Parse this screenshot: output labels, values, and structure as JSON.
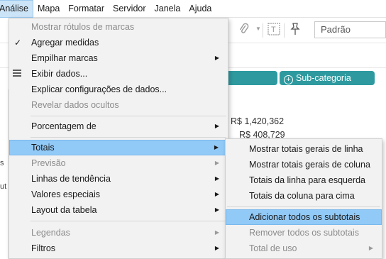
{
  "menubar": {
    "items": [
      {
        "label": "Análise",
        "active": true
      },
      {
        "label": "Mapa"
      },
      {
        "label": "Formatar"
      },
      {
        "label": "Servidor"
      },
      {
        "label": "Janela"
      },
      {
        "label": "Ajuda"
      }
    ]
  },
  "toolbar": {
    "format_value": "Padrão"
  },
  "shelf": {
    "pill_label": "Sub-categoria",
    "pill_color": "#2e9a9f"
  },
  "canvas": {
    "value_1": "R$ 1,420,362",
    "value_2": "R$ 408,729"
  },
  "left_strip": {
    "text_1": "s",
    "text_2": "ut"
  },
  "analise_menu": {
    "items": [
      {
        "label": "Mostrar rótulos de marcas",
        "disabled": true
      },
      {
        "label": "Agregar medidas",
        "checked": true
      },
      {
        "label": "Empilhar marcas",
        "submenu": true
      },
      {
        "label": "Exibir dados...",
        "icon": "data-grid-icon"
      },
      {
        "label": "Explicar configurações de dados..."
      },
      {
        "label": "Revelar dados ocultos",
        "disabled": true
      },
      {
        "label": "Porcentagem de",
        "submenu": true
      },
      {
        "label": "Totais",
        "submenu": true,
        "highlighted": true
      },
      {
        "label": "Previsão",
        "submenu": true,
        "disabled": true
      },
      {
        "label": "Linhas de tendência",
        "submenu": true
      },
      {
        "label": "Valores especiais",
        "submenu": true
      },
      {
        "label": "Layout da tabela",
        "submenu": true
      },
      {
        "label": "Legendas",
        "submenu": true,
        "disabled": true
      },
      {
        "label": "Filtros",
        "submenu": true
      }
    ]
  },
  "totais_menu": {
    "items": [
      {
        "label": "Mostrar totais gerais de linha"
      },
      {
        "label": "Mostrar totais gerais de coluna"
      },
      {
        "label": "Totais da linha para esquerda"
      },
      {
        "label": "Totais da coluna para cima"
      },
      {
        "label": "Adicionar todos os subtotais",
        "highlighted": true
      },
      {
        "label": "Remover todos os subtotais",
        "disabled": true
      },
      {
        "label": "Total de uso",
        "submenu": true,
        "disabled": true
      }
    ]
  },
  "colors": {
    "highlight": "#91c9f7",
    "menu_background": "#f2f2f2",
    "disabled_text": "#8c8c8c"
  }
}
